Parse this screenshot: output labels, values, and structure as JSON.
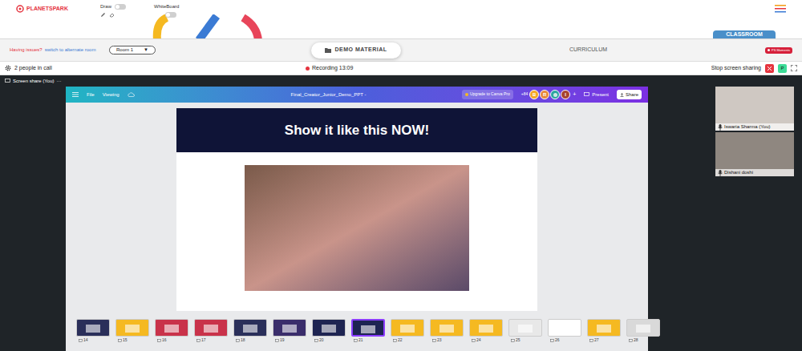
{
  "app": {
    "logo": "PLANETSPARK"
  },
  "toolbar": {
    "toggles": [
      {
        "label": "Draw",
        "on": false
      },
      {
        "label": "WhiteBoard",
        "on": false
      }
    ]
  },
  "room_bar": {
    "issue_text": "Having issues?",
    "switch_link": "switch to alternate room",
    "room": "Room 1",
    "room_arrow": "▼",
    "demo_material": "DEMO MATERIAL",
    "curriculum": "CURRICULUM",
    "classroom_tab": "CLASSROOM",
    "moments_badge": "PS Moments"
  },
  "call_bar": {
    "people": "2 people in call",
    "recording": "Recording 13:09",
    "stop_share": "Stop screen sharing",
    "user_initial": "P"
  },
  "share_tab": {
    "label": "Screen share (You)",
    "more": "···"
  },
  "canva": {
    "menu": [
      "File",
      "Viewing"
    ],
    "title": "Final_Creator_Junior_Demo_PPT -",
    "upgrade": "Upgrade to Canva Pro",
    "collaborator_count": "+84",
    "avatars": [
      {
        "kind": "initial",
        "initial": "B",
        "color": "#f5a623"
      },
      {
        "kind": "initial",
        "initial": "R",
        "color": "#e8893a"
      },
      {
        "kind": "photo",
        "initial": "",
        "color": "#2aa6a0"
      },
      {
        "kind": "initial",
        "initial": "I",
        "color": "#a8432f"
      }
    ],
    "add": "+",
    "present": "Present",
    "share": "Share"
  },
  "slide": {
    "title": "Show it like this NOW!"
  },
  "thumbnails": [
    {
      "number": "14",
      "selected": false,
      "color": "#2a2f5a"
    },
    {
      "number": "15",
      "selected": false,
      "color": "#f5b921"
    },
    {
      "number": "16",
      "selected": false,
      "color": "#c9324a"
    },
    {
      "number": "17",
      "selected": false,
      "color": "#c9324a"
    },
    {
      "number": "18",
      "selected": false,
      "color": "#2a2f5a"
    },
    {
      "number": "19",
      "selected": false,
      "color": "#3a2d6b"
    },
    {
      "number": "20",
      "selected": false,
      "color": "#1e2452"
    },
    {
      "number": "21",
      "selected": true,
      "color": "#1e2452"
    },
    {
      "number": "22",
      "selected": false,
      "color": "#f5b921"
    },
    {
      "number": "23",
      "selected": false,
      "color": "#f5b921"
    },
    {
      "number": "24",
      "selected": false,
      "color": "#f5b921"
    },
    {
      "number": "25",
      "selected": false,
      "color": "#e8e8e8"
    },
    {
      "number": "26",
      "selected": false,
      "color": "#ffffff"
    },
    {
      "number": "27",
      "selected": false,
      "color": "#f5b921"
    },
    {
      "number": "28",
      "selected": false,
      "color": "#d9d9d9"
    }
  ],
  "participants": [
    {
      "name": "Iswaria Sharma (You)"
    },
    {
      "name": "Dishani doshi"
    }
  ]
}
